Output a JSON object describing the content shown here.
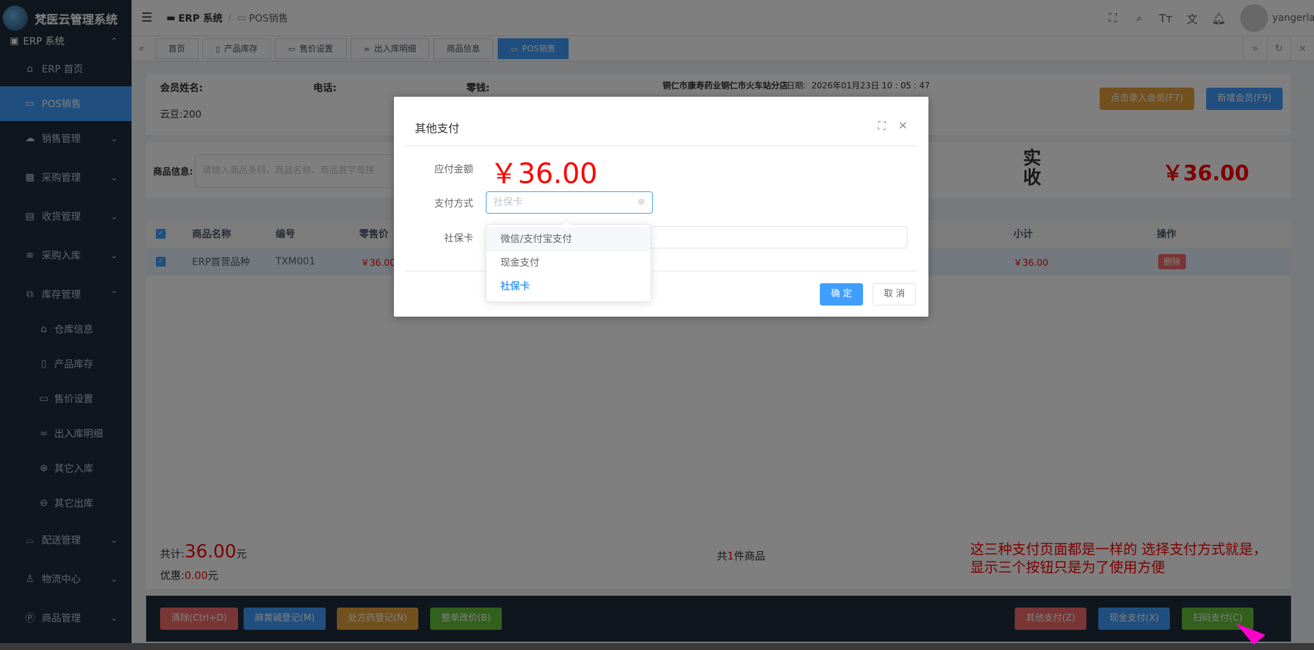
{
  "app": {
    "logo_text": "梵医云管理系统"
  },
  "sidebar": {
    "group_title": "ERP 系统",
    "items": [
      {
        "icon": "home-icon",
        "label": "ERP 首页"
      },
      {
        "icon": "pos-icon",
        "label": "POS销售"
      },
      {
        "icon": "cloud-icon",
        "label": "销售管理"
      },
      {
        "icon": "purchase-icon",
        "label": "采购管理"
      },
      {
        "icon": "card-icon",
        "label": "收货管理"
      },
      {
        "icon": "database-icon",
        "label": "采购入库"
      },
      {
        "icon": "stock-icon",
        "label": "库存管理"
      }
    ],
    "sub_items": [
      {
        "icon": "warehouse-icon",
        "label": "仓库信息"
      },
      {
        "icon": "trash-icon",
        "label": "产品库存"
      },
      {
        "icon": "price-icon",
        "label": "售价设置"
      },
      {
        "icon": "link-icon",
        "label": "出入库明细"
      },
      {
        "icon": "plus-circle-icon",
        "label": "其它入库"
      },
      {
        "icon": "minus-circle-icon",
        "label": "其它出库"
      }
    ],
    "bottom_items": [
      {
        "icon": "delivery-icon",
        "label": "配送管理"
      },
      {
        "icon": "user-icon",
        "label": "物流中心"
      },
      {
        "icon": "product-icon",
        "label": "商品管理"
      }
    ]
  },
  "navbar": {
    "breadcrumb_root": "ERP 系统",
    "breadcrumb_current": "POS销售",
    "username": "yangerlan"
  },
  "tags": [
    "首页",
    "产品库存",
    "售价设置",
    "出入库明细",
    "商品信息",
    "POS销售"
  ],
  "member": {
    "name_label": "会员姓名:",
    "phone_label": "电话:",
    "change_label": "零钱:",
    "store": "铜仁市康寿药业铜仁市火车站分店",
    "date_label": "日期:",
    "date_value": "2026年01月23日 10 : 05 : 47",
    "cloud_beans": "云豆:200",
    "btn_enter_member": "点击录入会员(F7)",
    "btn_new_member": "新增会员(F9)"
  },
  "goods": {
    "label": "商品信息:",
    "placeholder": "请输入商品条码、商品名称、商品首字母拼",
    "received_label": "实收",
    "received_amount": "￥36.00"
  },
  "table": {
    "headers": [
      "商品名称",
      "编号",
      "零售价",
      "小计",
      "操作"
    ],
    "rows": [
      {
        "name": "ERP首营品种",
        "code": "TXM001",
        "price": "￥36.00",
        "subtotal": "￥36.00",
        "action": "删除"
      }
    ]
  },
  "summary": {
    "total_prefix": "共计:",
    "total_value": "36.00",
    "total_suffix": "元",
    "discount_prefix": "优惠:",
    "discount_value": "0.00",
    "discount_suffix": "元",
    "count_prefix": "共",
    "count_value": "1",
    "count_suffix": "件商品"
  },
  "note": "这三种支付页面都是一样的  选择支付方式就是，显示三个按钮只是为了使用方便",
  "footer_buttons": {
    "clear": "清除(Ctrl+D)",
    "ephedrine": "麻黄碱登记(M)",
    "prescription": "处方药登记(N)",
    "reprice": "整单改价(B)",
    "other_pay": "其他支付(Z)",
    "cash_pay": "现金支付(X)",
    "scan_pay": "扫码支付(C)"
  },
  "modal": {
    "title": "其他支付",
    "amount_label": "应付金额",
    "amount_value": "￥36.00",
    "method_label": "支付方式",
    "method_value": "社保卡",
    "card_label": "社保卡",
    "confirm": "确 定",
    "cancel": "取 消",
    "options": [
      "微信/支付宝支付",
      "现金支付",
      "社保卡"
    ]
  }
}
